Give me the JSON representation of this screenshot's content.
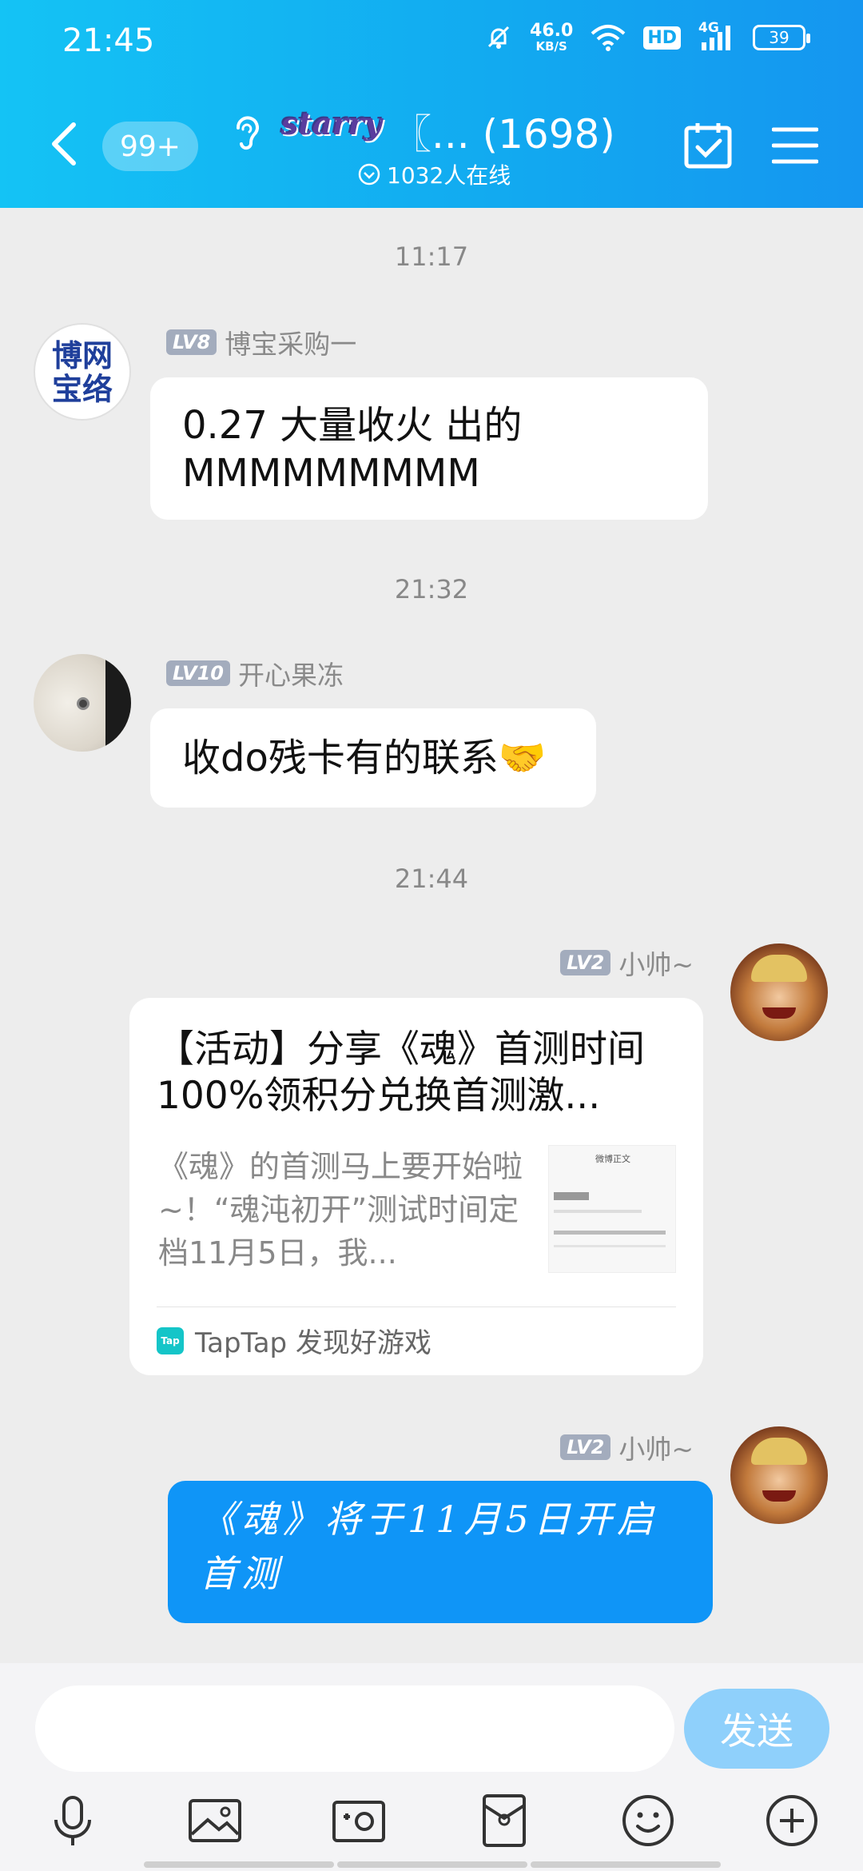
{
  "status": {
    "time": "21:45",
    "net_speed_value": "46.0",
    "net_speed_unit": "KB/S",
    "hd": "HD",
    "signal": "4G",
    "battery": "39"
  },
  "header": {
    "unread": "99+",
    "group_logo": "starry",
    "title": "〖... (1698)",
    "online": "1032人在线"
  },
  "messages": {
    "m1": {
      "time": "11:17",
      "avatar_text": "博网宝络",
      "level": "LV8",
      "sender": "博宝采购一",
      "line1": "0.27 大量收火  出的",
      "line2": "MMMMMMMMM"
    },
    "m2": {
      "time": "21:32",
      "level": "LV10",
      "sender": "开心果冻",
      "text": "收do残卡有的联系🤝"
    },
    "m3": {
      "time": "21:44",
      "level": "LV2",
      "sender": "小帅~",
      "card_title": "【活动】分享《魂》首测时间 100%领积分兑换首测激...",
      "card_desc": "《魂》的首测马上要开始啦~！“魂沌初开”测试时间定档11月5日，我...",
      "thumb_title": "微博正文",
      "source_icon": "Tap",
      "source": "TapTap 发现好游戏"
    },
    "m4": {
      "level": "LV2",
      "sender": "小帅~",
      "text": "《魂》将于11月5日开启首测"
    }
  },
  "input": {
    "placeholder": "",
    "send": "发送"
  },
  "colors": {
    "header": "#12a9f0",
    "bubble_blue": "#0f95f7",
    "send_button": "#8fd0fb"
  }
}
